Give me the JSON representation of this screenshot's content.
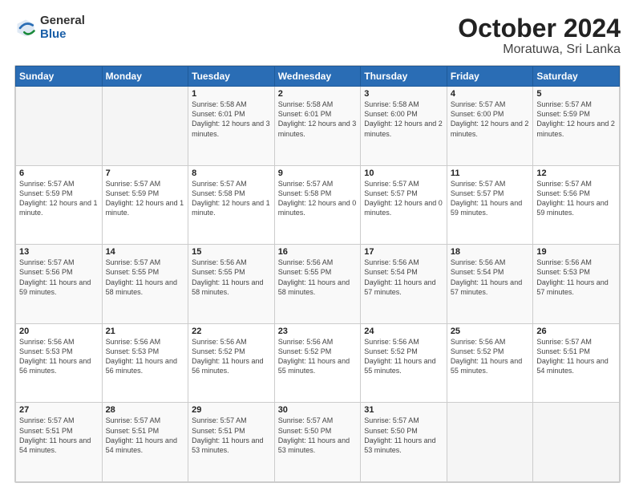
{
  "header": {
    "logo_general": "General",
    "logo_blue": "Blue",
    "title": "October 2024",
    "subtitle": "Moratuwa, Sri Lanka"
  },
  "calendar": {
    "columns": [
      "Sunday",
      "Monday",
      "Tuesday",
      "Wednesday",
      "Thursday",
      "Friday",
      "Saturday"
    ],
    "weeks": [
      [
        {
          "day": "",
          "info": ""
        },
        {
          "day": "",
          "info": ""
        },
        {
          "day": "1",
          "info": "Sunrise: 5:58 AM\nSunset: 6:01 PM\nDaylight: 12 hours\nand 3 minutes."
        },
        {
          "day": "2",
          "info": "Sunrise: 5:58 AM\nSunset: 6:01 PM\nDaylight: 12 hours\nand 3 minutes."
        },
        {
          "day": "3",
          "info": "Sunrise: 5:58 AM\nSunset: 6:00 PM\nDaylight: 12 hours\nand 2 minutes."
        },
        {
          "day": "4",
          "info": "Sunrise: 5:57 AM\nSunset: 6:00 PM\nDaylight: 12 hours\nand 2 minutes."
        },
        {
          "day": "5",
          "info": "Sunrise: 5:57 AM\nSunset: 5:59 PM\nDaylight: 12 hours\nand 2 minutes."
        }
      ],
      [
        {
          "day": "6",
          "info": "Sunrise: 5:57 AM\nSunset: 5:59 PM\nDaylight: 12 hours\nand 1 minute."
        },
        {
          "day": "7",
          "info": "Sunrise: 5:57 AM\nSunset: 5:59 PM\nDaylight: 12 hours\nand 1 minute."
        },
        {
          "day": "8",
          "info": "Sunrise: 5:57 AM\nSunset: 5:58 PM\nDaylight: 12 hours\nand 1 minute."
        },
        {
          "day": "9",
          "info": "Sunrise: 5:57 AM\nSunset: 5:58 PM\nDaylight: 12 hours\nand 0 minutes."
        },
        {
          "day": "10",
          "info": "Sunrise: 5:57 AM\nSunset: 5:57 PM\nDaylight: 12 hours\nand 0 minutes."
        },
        {
          "day": "11",
          "info": "Sunrise: 5:57 AM\nSunset: 5:57 PM\nDaylight: 11 hours\nand 59 minutes."
        },
        {
          "day": "12",
          "info": "Sunrise: 5:57 AM\nSunset: 5:56 PM\nDaylight: 11 hours\nand 59 minutes."
        }
      ],
      [
        {
          "day": "13",
          "info": "Sunrise: 5:57 AM\nSunset: 5:56 PM\nDaylight: 11 hours\nand 59 minutes."
        },
        {
          "day": "14",
          "info": "Sunrise: 5:57 AM\nSunset: 5:55 PM\nDaylight: 11 hours\nand 58 minutes."
        },
        {
          "day": "15",
          "info": "Sunrise: 5:56 AM\nSunset: 5:55 PM\nDaylight: 11 hours\nand 58 minutes."
        },
        {
          "day": "16",
          "info": "Sunrise: 5:56 AM\nSunset: 5:55 PM\nDaylight: 11 hours\nand 58 minutes."
        },
        {
          "day": "17",
          "info": "Sunrise: 5:56 AM\nSunset: 5:54 PM\nDaylight: 11 hours\nand 57 minutes."
        },
        {
          "day": "18",
          "info": "Sunrise: 5:56 AM\nSunset: 5:54 PM\nDaylight: 11 hours\nand 57 minutes."
        },
        {
          "day": "19",
          "info": "Sunrise: 5:56 AM\nSunset: 5:53 PM\nDaylight: 11 hours\nand 57 minutes."
        }
      ],
      [
        {
          "day": "20",
          "info": "Sunrise: 5:56 AM\nSunset: 5:53 PM\nDaylight: 11 hours\nand 56 minutes."
        },
        {
          "day": "21",
          "info": "Sunrise: 5:56 AM\nSunset: 5:53 PM\nDaylight: 11 hours\nand 56 minutes."
        },
        {
          "day": "22",
          "info": "Sunrise: 5:56 AM\nSunset: 5:52 PM\nDaylight: 11 hours\nand 56 minutes."
        },
        {
          "day": "23",
          "info": "Sunrise: 5:56 AM\nSunset: 5:52 PM\nDaylight: 11 hours\nand 55 minutes."
        },
        {
          "day": "24",
          "info": "Sunrise: 5:56 AM\nSunset: 5:52 PM\nDaylight: 11 hours\nand 55 minutes."
        },
        {
          "day": "25",
          "info": "Sunrise: 5:56 AM\nSunset: 5:52 PM\nDaylight: 11 hours\nand 55 minutes."
        },
        {
          "day": "26",
          "info": "Sunrise: 5:57 AM\nSunset: 5:51 PM\nDaylight: 11 hours\nand 54 minutes."
        }
      ],
      [
        {
          "day": "27",
          "info": "Sunrise: 5:57 AM\nSunset: 5:51 PM\nDaylight: 11 hours\nand 54 minutes."
        },
        {
          "day": "28",
          "info": "Sunrise: 5:57 AM\nSunset: 5:51 PM\nDaylight: 11 hours\nand 54 minutes."
        },
        {
          "day": "29",
          "info": "Sunrise: 5:57 AM\nSunset: 5:51 PM\nDaylight: 11 hours\nand 53 minutes."
        },
        {
          "day": "30",
          "info": "Sunrise: 5:57 AM\nSunset: 5:50 PM\nDaylight: 11 hours\nand 53 minutes."
        },
        {
          "day": "31",
          "info": "Sunrise: 5:57 AM\nSunset: 5:50 PM\nDaylight: 11 hours\nand 53 minutes."
        },
        {
          "day": "",
          "info": ""
        },
        {
          "day": "",
          "info": ""
        }
      ]
    ]
  }
}
